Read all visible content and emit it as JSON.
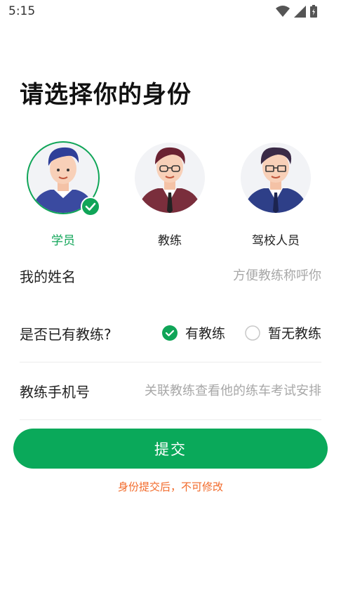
{
  "status_bar": {
    "time": "5:15",
    "icons": [
      "wifi-icon",
      "signal-icon",
      "battery-icon"
    ]
  },
  "page": {
    "title": "请选择你的身份"
  },
  "roles": [
    {
      "label": "学员",
      "selected": true
    },
    {
      "label": "教练",
      "selected": false
    },
    {
      "label": "驾校人员",
      "selected": false
    }
  ],
  "name_field": {
    "label": "我的姓名",
    "placeholder": "方便教练称呼你",
    "value": ""
  },
  "coach_field": {
    "label": "是否已有教练?",
    "options": [
      {
        "label": "有教练",
        "selected": true
      },
      {
        "label": "暂无教练",
        "selected": false
      }
    ]
  },
  "phone_field": {
    "label": "教练手机号",
    "placeholder": "关联教练查看他的练车考试安排",
    "value": ""
  },
  "submit": {
    "label": "提交"
  },
  "notice": "身份提交后，不可修改",
  "colors": {
    "accent": "#0aa95a",
    "warning": "#f26a2a",
    "placeholder": "#a8a8a8"
  }
}
